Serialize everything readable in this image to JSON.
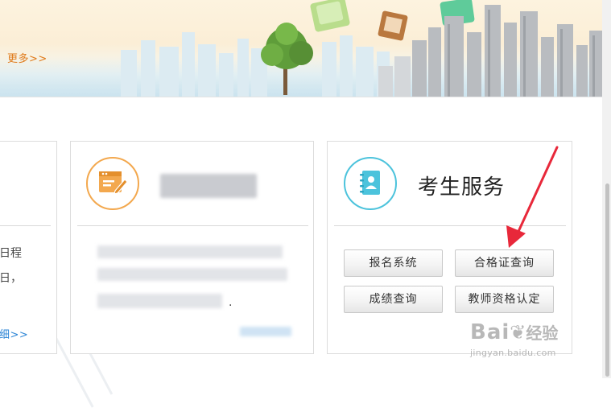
{
  "banner": {
    "more_label": "更多>>"
  },
  "left_card": {
    "lines": [
      "日程",
      "日，"
    ],
    "detail_link": "细>>"
  },
  "middle_card": {
    "icon": "certificate-pen-icon",
    "trailing_period": "."
  },
  "service_card": {
    "icon": "address-book-icon",
    "title": "考生服务",
    "buttons": {
      "signup": "报名系统",
      "certificate_query": "合格证查询",
      "score_query": "成绩查询",
      "teacher_cert": "教师资格认定"
    }
  },
  "watermark": {
    "brand": "Bai",
    "brand_tail": "经验",
    "url": "jingyan.baidu.com"
  },
  "colors": {
    "accent_orange": "#f3a84e",
    "accent_cyan": "#4cc3dc",
    "link_blue": "#2e86d6",
    "more_orange": "#e07a1a",
    "arrow_red": "#e8283a"
  }
}
